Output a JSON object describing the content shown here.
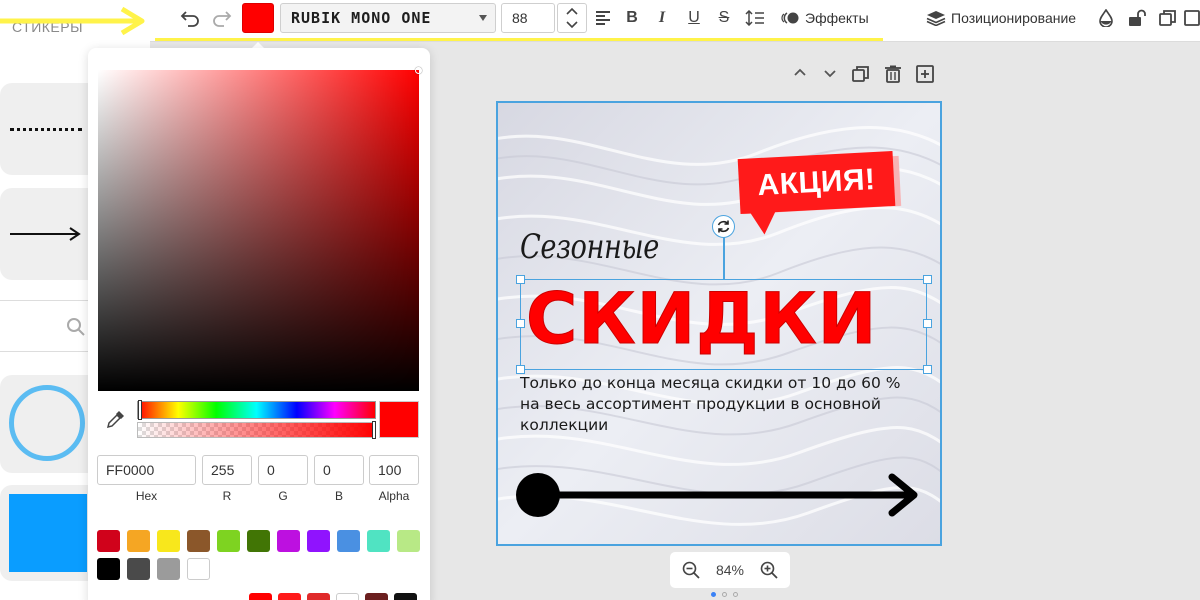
{
  "left_panel": {
    "title": "СТИКЕРЫ"
  },
  "toolbar": {
    "font_family": "RUBIK MONO ONE",
    "font_size": "88",
    "effects_label": "Эффекты",
    "positioning_label": "Позиционирование",
    "text_color": "#ff0000"
  },
  "color_picker": {
    "hex_value": "FF0000",
    "r_value": "255",
    "g_value": "0",
    "b_value": "0",
    "alpha_value": "100",
    "labels": {
      "hex": "Hex",
      "r": "R",
      "g": "G",
      "b": "B",
      "alpha": "Alpha"
    },
    "presets": [
      "#d0021b",
      "#f5a623",
      "#f8e71c",
      "#8b572a",
      "#7ed321",
      "#417505",
      "#bd10e0",
      "#9013fe",
      "#4a90e2",
      "#50e3c2",
      "#b8e986",
      "#000000",
      "#4a4a4a",
      "#9b9b9b",
      "#ffffff"
    ],
    "recent": [
      "#ff0000",
      "#ff1a1a",
      "#e02a2a",
      "#ffffff",
      "#6b1f1f",
      "#111111"
    ]
  },
  "design": {
    "badge": "АКЦИЯ!",
    "script_title": "Сезонные",
    "main_title": "СКИДКИ",
    "body_text": "Только до конца месяца скидки от 10 до 60 % на весь ассортимент продукции в основной коллекции"
  },
  "zoom": {
    "value": "84%"
  }
}
